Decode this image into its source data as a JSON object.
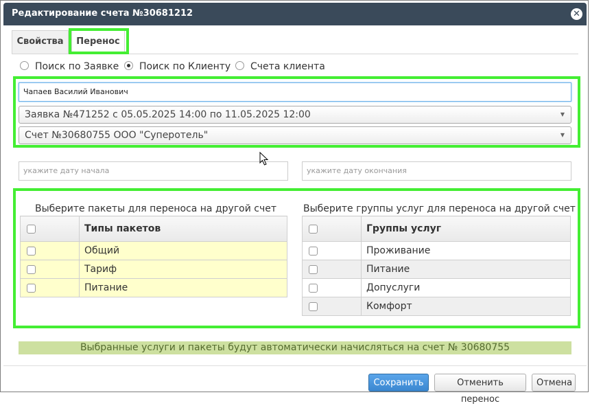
{
  "dialog": {
    "title": "Редактирование счета №30681212",
    "close_icon": "close-icon"
  },
  "tabs": [
    {
      "label": "Свойства"
    },
    {
      "label": "Перенос"
    }
  ],
  "search_mode": {
    "options": [
      {
        "label": "Поиск по Заявке",
        "checked": false
      },
      {
        "label": "Поиск по Клиенту",
        "checked": true
      },
      {
        "label": "Счета клиента",
        "checked": false
      }
    ]
  },
  "client_input": {
    "value": "Чапаев Василий Иванович"
  },
  "order_select": {
    "value": "Заявка №471252 с 05.05.2025 14:00 по 11.05.2025 12:00"
  },
  "account_select": {
    "value": "Счет №30680755 ООО \"Суперотель\""
  },
  "dates": {
    "start_placeholder": "укажите дату начала",
    "end_placeholder": "укажите дату окончания"
  },
  "packages": {
    "title": "Выберите пакеты для переноса на другой счет",
    "header": "Типы пакетов",
    "rows": [
      "Общий",
      "Тариф",
      "Питание"
    ]
  },
  "service_groups": {
    "title": "Выберите группы услуг для переноса на другой счет",
    "header": "Группы услуг",
    "rows": [
      "Проживание",
      "Питание",
      "Допуслуги",
      "Комфорт"
    ]
  },
  "notice": "Выбранные услуги и пакеты будут автоматически начисляться на счет № 30680755",
  "buttons": {
    "save": "Сохранить",
    "cancel_transfer": "Отменить перенос",
    "cancel": "Отмена"
  },
  "colors": {
    "highlight": "#44ee33",
    "titlebar": "#3a4a5a",
    "primary": "#428bca",
    "notice_bg": "#cde0a0"
  }
}
